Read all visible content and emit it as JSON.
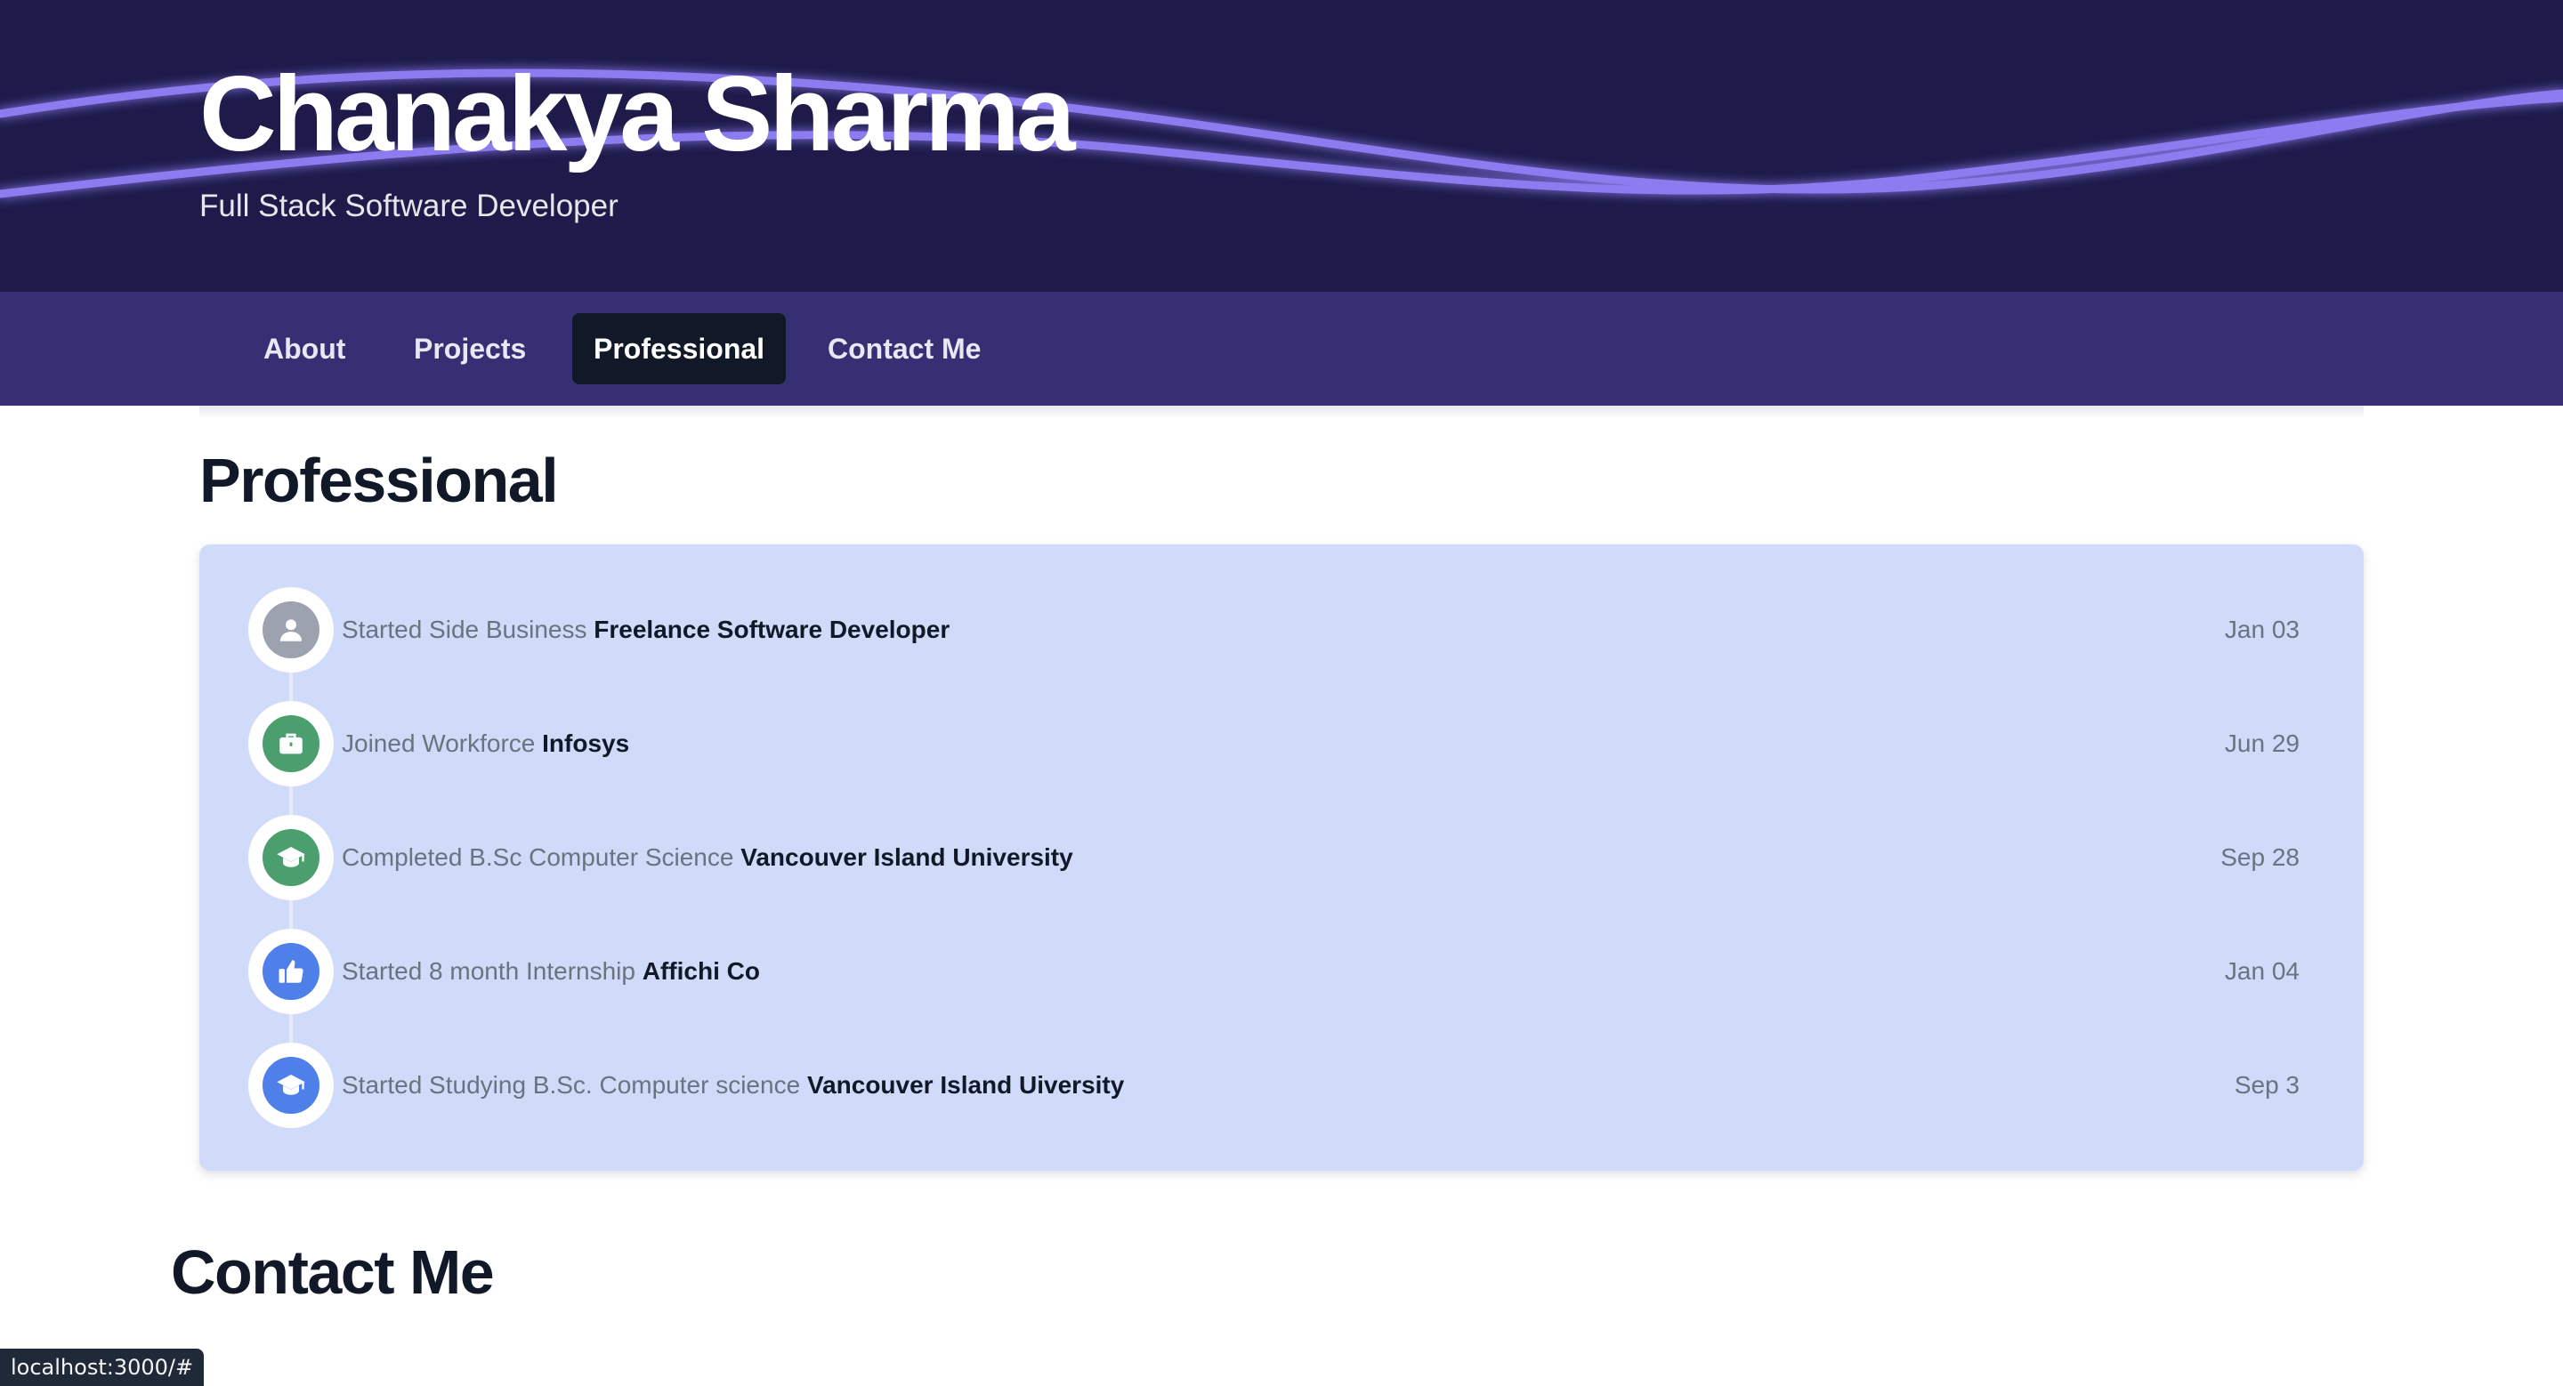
{
  "hero": {
    "name": "Chanakya Sharma",
    "subtitle": "Full Stack Software Developer",
    "background_color": "#1e1b4b",
    "wave_color": "#8b7cf0"
  },
  "nav": {
    "background_color": "#372f74",
    "items": [
      {
        "label": "About",
        "active": false
      },
      {
        "label": "Projects",
        "active": false
      },
      {
        "label": "Professional",
        "active": true
      },
      {
        "label": "Contact Me",
        "active": false
      }
    ]
  },
  "professional": {
    "heading": "Professional",
    "timeline": [
      {
        "label": "Started Side Business",
        "target": "Freelance Software Developer",
        "date": "Jan 03",
        "icon": "user-icon",
        "icon_color": "#9ca3af"
      },
      {
        "label": "Joined Workforce",
        "target": "Infosys",
        "date": "Jun 29",
        "icon": "briefcase-icon",
        "icon_color": "#4b9e6e"
      },
      {
        "label": "Completed B.Sc Computer Science",
        "target": "Vancouver Island University",
        "date": "Sep 28",
        "icon": "graduation-cap-icon",
        "icon_color": "#4b9e6e"
      },
      {
        "label": "Started 8 month Internship",
        "target": "Affichi Co",
        "date": "Jan 04",
        "icon": "thumbs-up-icon",
        "icon_color": "#4f7fe8"
      },
      {
        "label": "Started Studying B.Sc. Computer science",
        "target": "Vancouver Island Uiversity",
        "date": "Sep 3",
        "icon": "graduation-cap-icon",
        "icon_color": "#4f7fe8"
      }
    ]
  },
  "contact": {
    "heading": "Contact Me"
  },
  "status_bar": {
    "url": "localhost:3000/#"
  }
}
